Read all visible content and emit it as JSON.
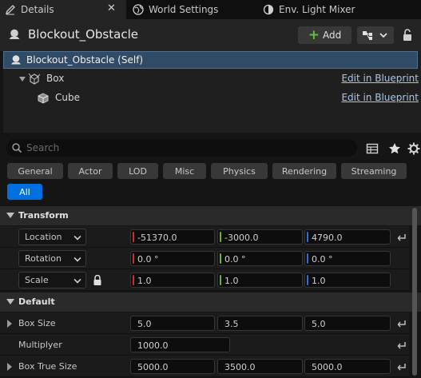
{
  "tabs": [
    {
      "label": "Details",
      "active": true
    },
    {
      "label": "World Settings",
      "active": false
    },
    {
      "label": "Env. Light Mixer",
      "active": false
    }
  ],
  "tab_close_icon": "close-icon",
  "header": {
    "actor_name": "Blockout_Obstacle",
    "add_label": "Add"
  },
  "tree": {
    "self_label": "Blockout_Obstacle (Self)",
    "box_label": "Box",
    "cube_label": "Cube",
    "edit_link": "Edit in Blueprint"
  },
  "search": {
    "placeholder": "Search"
  },
  "filters": [
    "General",
    "Actor",
    "LOD",
    "Misc",
    "Physics",
    "Rendering",
    "Streaming",
    "All"
  ],
  "active_filter": "All",
  "transform": {
    "title": "Transform",
    "location": {
      "label": "Location",
      "x": "-51370.0",
      "y": "-3000.0",
      "z": "4790.0"
    },
    "rotation": {
      "label": "Rotation",
      "x": "0.0 °",
      "y": "0.0 °",
      "z": "0.0 °"
    },
    "scale": {
      "label": "Scale",
      "x": "1.0",
      "y": "1.0",
      "z": "1.0"
    }
  },
  "default": {
    "title": "Default",
    "box_size": {
      "label": "Box Size",
      "x": "5.0",
      "y": "3.5",
      "z": "5.0"
    },
    "multiplyer": {
      "label": "Multiplyer",
      "value": "1000.0"
    },
    "box_true_size": {
      "label": "Box True Size",
      "x": "5000.0",
      "y": "3500.0",
      "z": "5000.0"
    }
  },
  "colors": {
    "accent": "#0070e0",
    "selection": "#2f4b66",
    "link": "#a8c7ee",
    "axis_x": "#c8302e",
    "axis_y": "#6bb33a",
    "axis_z": "#2e6fd6",
    "add_plus": "#5fbf3f"
  }
}
